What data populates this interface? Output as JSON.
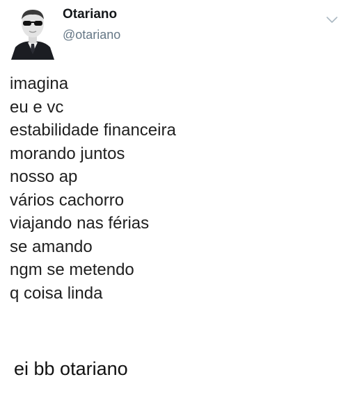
{
  "tweet": {
    "author_name": "Otariano",
    "author_handle": "@otariano",
    "lines": [
      "imagina",
      "eu e vc",
      "estabilidade financeira",
      "morando juntos",
      "nosso ap",
      "vários cachorro",
      "viajando nas férias",
      "se amando",
      "ngm se metendo",
      "q coisa linda"
    ]
  },
  "caption": "ei bb otariano",
  "icons": {
    "avatar": "avatar-man-in-suit-sunglasses",
    "menu": "chevron-down-icon"
  },
  "colors": {
    "handle": "#657786",
    "name": "#14171a",
    "text": "#1f1f1f",
    "chevron": "#aab8c2"
  }
}
